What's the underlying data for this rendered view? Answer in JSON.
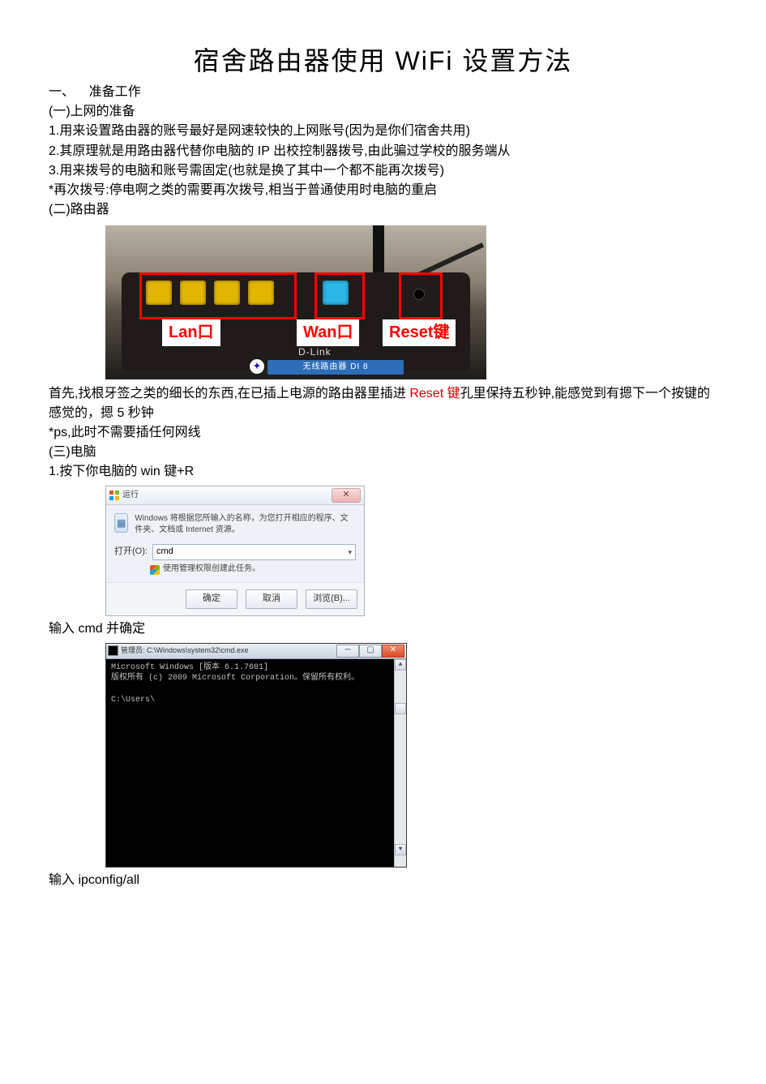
{
  "title": "宿舍路由器使用 WiFi 设置方法",
  "section1": {
    "num": "一、",
    "label": "准备工作",
    "sub1": {
      "heading": "(一)上网的准备",
      "items": [
        "1.用来设置路由器的账号最好是网速较快的上网账号(因为是你们宿舍共用)",
        "2.其原理就是用路由器代替你电脑的 IP 出校控制器拨号,由此骗过学校的服务端从",
        "3.用来拨号的电脑和账号需固定(也就是换了其中一个都不能再次拨号)"
      ],
      "note": "*再次拨号:停电啊之类的需要再次拨号,相当于普通使用时电脑的重启"
    },
    "sub2": {
      "heading": "(二)路由器",
      "router": {
        "lan_label": "Lan口",
        "wan_label": "Wan口",
        "reset_label": "Reset键",
        "dlink": "D-Link",
        "strip": "无线路由器  DI 8"
      },
      "desc_pre": "首先,找根牙签之类的细长的东西,在已插上电源的路由器里插进 ",
      "desc_red": "Reset 键",
      "desc_post": "孔里保持五秒钟,能感觉到有摁下一个按键的感觉的，摁 5 秒钟",
      "ps": "*ps,此时不需要插任何网线"
    },
    "sub3": {
      "heading": "(三)电脑",
      "step1": "1.按下你电脑的 win 键+R",
      "run_dialog": {
        "title": "运行",
        "description": "Windows 将根据您所输入的名称，为您打开相应的程序、文件夹、文档或 Internet 资源。",
        "open_label": "打开(O):",
        "open_value": "cmd",
        "shield_text": "使用管理权限创建此任务。",
        "buttons": {
          "ok": "确定",
          "cancel": "取消",
          "browse": "浏览(B)..."
        }
      },
      "run_instruction": "输入 cmd 并确定",
      "cmd_window": {
        "title": "管理员: C:\\Windows\\system32\\cmd.exe",
        "line1": "Microsoft Windows [版本 6.1.7601]",
        "line2": "版权所有 (c) 2009 Microsoft Corporation。保留所有权利。",
        "line3": "C:\\Users\\"
      },
      "cmd_instruction": "输入   ipconfig/all"
    }
  }
}
